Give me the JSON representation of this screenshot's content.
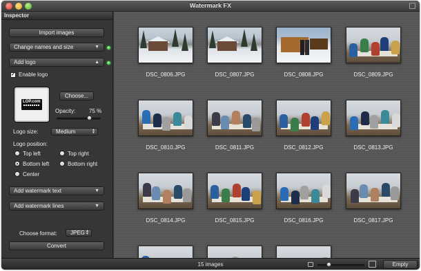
{
  "window": {
    "title": "Watermark FX"
  },
  "inspector": {
    "title": "Inspector",
    "import_label": "Import images",
    "change_names_label": "Change names and size",
    "add_logo_label": "Add logo",
    "enable_logo_label": "Enable logo",
    "enable_logo_checked": true,
    "logo_image_text": "LOP.com",
    "choose_label": "Choose...",
    "opacity_label": "Opacity:",
    "opacity_value_text": "75 %",
    "opacity_value": 0.75,
    "logo_size_label": "Logo size:",
    "logo_size_value": "Medium",
    "logo_position_label": "Logo position:",
    "positions": {
      "top_left": "Top left",
      "top_right": "Top right",
      "bottom_left": "Bottom left",
      "bottom_right": "Bottom right",
      "center": "Center"
    },
    "selected_position": "bottom_left",
    "add_watermark_text_label": "Add watermark text",
    "add_watermark_lines_label": "Add watermark lines",
    "choose_format_label": "Choose format:",
    "format_value": "JPEG",
    "convert_label": "Convert",
    "status_led_color": "#2bb02b"
  },
  "images": [
    {
      "name": "DSC_0806.JPG",
      "scene": "snow"
    },
    {
      "name": "DSC_0807.JPG",
      "scene": "snow"
    },
    {
      "name": "DSC_0808.JPG",
      "scene": "cabin"
    },
    {
      "name": "DSC_0809.JPG",
      "scene": "room"
    },
    {
      "name": "DSC_0810.JPG",
      "scene": "room"
    },
    {
      "name": "DSC_0811.JPG",
      "scene": "room"
    },
    {
      "name": "DSC_0812.JPG",
      "scene": "room"
    },
    {
      "name": "DSC_0813.JPG",
      "scene": "room"
    },
    {
      "name": "DSC_0814.JPG",
      "scene": "room"
    },
    {
      "name": "DSC_0815.JPG",
      "scene": "room"
    },
    {
      "name": "DSC_0816.JPG",
      "scene": "room"
    },
    {
      "name": "DSC_0817.JPG",
      "scene": "room"
    }
  ],
  "bottom_bar": {
    "status_text": "15 images",
    "empty_label": "Empty",
    "zoom_level": 0.25
  }
}
